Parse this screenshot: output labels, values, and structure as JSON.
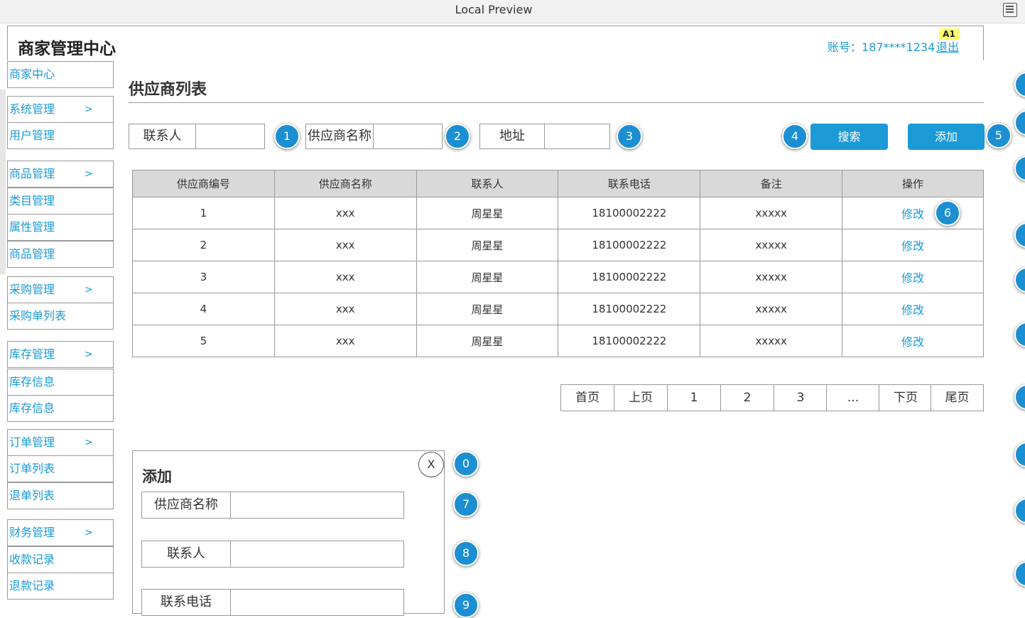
{
  "preview": {
    "title": "Local Preview"
  },
  "header": {
    "app_title": "商家管理中心",
    "account": "账号：187****1234",
    "logout": "退出",
    "badge": "A1"
  },
  "sidebar": {
    "items": [
      {
        "label": "商家中心",
        "chevron": ""
      },
      {
        "label": "系统管理",
        "chevron": ">"
      },
      {
        "label": "用户管理",
        "chevron": ""
      },
      {
        "label": "商品管理",
        "chevron": ">"
      },
      {
        "label": "类目管理",
        "chevron": ""
      },
      {
        "label": "属性管理",
        "chevron": ""
      },
      {
        "label": "商品管理",
        "chevron": ""
      },
      {
        "label": "采购管理",
        "chevron": ">"
      },
      {
        "label": "采购单列表",
        "chevron": ""
      },
      {
        "label": "库存管理",
        "chevron": ">"
      },
      {
        "label": "库存信息",
        "chevron": ""
      },
      {
        "label": "库存信息",
        "chevron": ""
      },
      {
        "label": "订单管理",
        "chevron": ">"
      },
      {
        "label": "订单列表",
        "chevron": ""
      },
      {
        "label": "退单列表",
        "chevron": ""
      },
      {
        "label": "财务管理",
        "chevron": ">"
      },
      {
        "label": "收款记录",
        "chevron": ""
      },
      {
        "label": "退款记录",
        "chevron": ""
      }
    ]
  },
  "page": {
    "title": "供应商列表"
  },
  "search": {
    "contact_label": "联系人",
    "contact_value": "",
    "name_label": "供应商名称",
    "name_value": "",
    "address_label": "地址",
    "address_value": "",
    "search_button": "搜索",
    "add_button": "添加"
  },
  "badges": {
    "b0": "0",
    "b1": "1",
    "b2": "2",
    "b3": "3",
    "b4": "4",
    "b5": "5",
    "b6": "6",
    "b7": "7",
    "b8": "8",
    "b9": "9"
  },
  "table": {
    "headers": [
      "供应商编号",
      "供应商名称",
      "联系人",
      "联系电话",
      "备注",
      "操作"
    ],
    "rows": [
      {
        "id": "1",
        "name": "xxx",
        "contact": "周星星",
        "phone": "18100002222",
        "note": "xxxxx",
        "action": "修改"
      },
      {
        "id": "2",
        "name": "xxx",
        "contact": "周星星",
        "phone": "18100002222",
        "note": "xxxxx",
        "action": "修改"
      },
      {
        "id": "3",
        "name": "xxx",
        "contact": "周星星",
        "phone": "18100002222",
        "note": "xxxxx",
        "action": "修改"
      },
      {
        "id": "4",
        "name": "xxx",
        "contact": "周星星",
        "phone": "18100002222",
        "note": "xxxxx",
        "action": "修改"
      },
      {
        "id": "5",
        "name": "xxx",
        "contact": "周星星",
        "phone": "18100002222",
        "note": "xxxxx",
        "action": "修改"
      }
    ]
  },
  "pagination": [
    "首页",
    "上页",
    "1",
    "2",
    "3",
    "...",
    "下页",
    "尾页"
  ],
  "dialog": {
    "title": "添加",
    "close": "X",
    "name_label": "供应商名称",
    "name_value": "",
    "contact_label": "联系人",
    "contact_value": "",
    "phone_label": "联系电话",
    "phone_value": ""
  },
  "colors": {
    "accent": "#1b9ad6",
    "badge": "#1b8fd2",
    "header_bg": "#d9d9d9",
    "border": "#999999"
  }
}
